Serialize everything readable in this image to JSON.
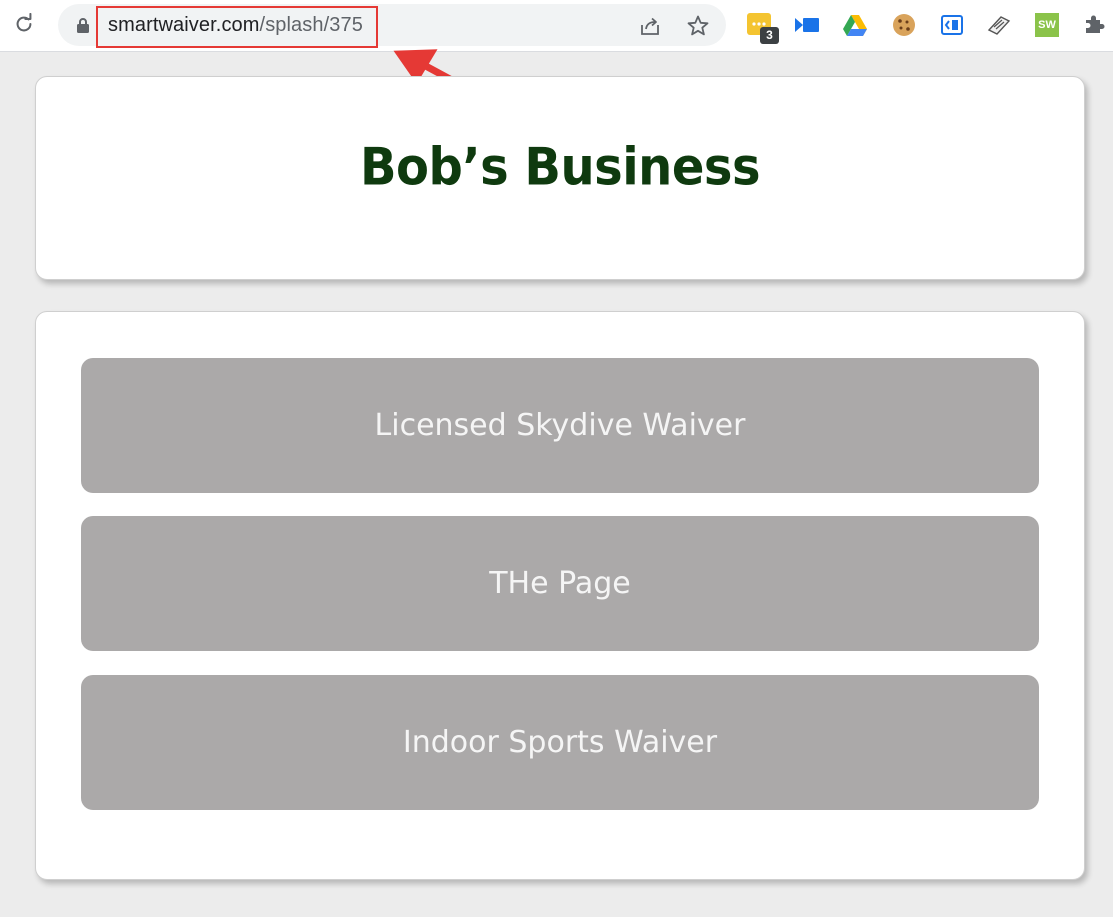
{
  "browser": {
    "url_domain": "smartwaiver.com",
    "url_path": "/splash/375",
    "extension_badge_count": "3",
    "extension_sw_label": "SW"
  },
  "page": {
    "logo_text": "Bob’s Business",
    "waivers": [
      {
        "label": "Licensed Skydive Waiver"
      },
      {
        "label": "THe Page"
      },
      {
        "label": "Indoor Sports Waiver"
      }
    ]
  },
  "colors": {
    "page_background": "#ececec",
    "card_background": "#ffffff",
    "button_background": "#aba9a9",
    "button_text": "#f5f5f5",
    "logo_text": "#0f3a0f",
    "annotation_red": "#e53935"
  },
  "icons": {
    "reload": "reload-icon",
    "lock": "lock-icon",
    "share": "share-icon",
    "star": "bookmark-star-icon",
    "extensions": [
      "notes-extension-icon",
      "video-extension-icon",
      "drive-extension-icon",
      "cookie-extension-icon",
      "code-extension-icon",
      "bookmark-manager-icon",
      "smartwaiver-extension-icon",
      "puzzle-extensions-icon"
    ]
  }
}
